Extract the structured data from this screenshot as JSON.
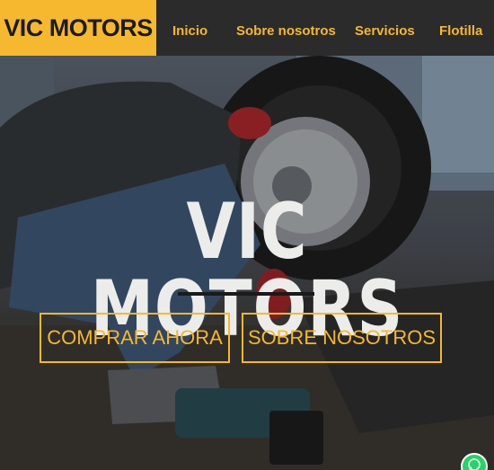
{
  "header": {
    "brand": "VIC MOTORS",
    "nav": [
      "Inicio",
      "Sobre nosotros",
      "Servicios",
      "Flotilla"
    ]
  },
  "hero": {
    "title": "VIC MOTORS",
    "buttons": [
      "COMPRAR AHORA",
      "SOBRE NOSOTROS"
    ]
  },
  "colors": {
    "accent": "#f5b82e",
    "header_bg": "#2b2b2b",
    "hero_text": "#ececea",
    "whatsapp": "#25d366"
  },
  "icons": [
    "whatsapp-icon"
  ]
}
